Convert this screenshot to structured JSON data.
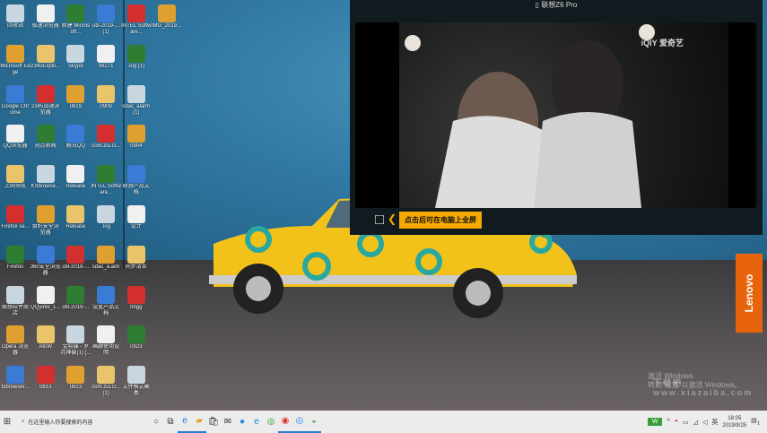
{
  "desktop": {
    "columns": [
      [
        "回收站",
        "Microsoft Edge",
        "Google Chrome",
        "QQ浏览器",
        "上网导航",
        "Firefox se...",
        "Firefox",
        "联想软件商店",
        "Opera 浏览器",
        "tsbrowser..."
      ],
      [
        "极速浏览器",
        "2345Explo...",
        "2345加速浏览器",
        "热点新闻",
        "KSbrowse...",
        "猎豹安全浏览器",
        "360安全浏览器",
        "QQyinle_1...",
        "AtoW",
        "0813"
      ],
      [
        "新建 Microsoft...",
        "Skype",
        "0819",
        "腾讯QQ",
        "Release",
        "Release",
        "util-2019-...",
        "util-2019-...",
        "金软碟 - 岁月神偷(1) [...",
        "0823"
      ],
      [
        "util-2019-... (1)",
        "08271",
        "0909",
        "com.zui.cl...",
        "INTEL Software...",
        ".log",
        "sdac_a.aim",
        "设置产品文档",
        "画廊使用说明",
        "com.zui.cl... (1)"
      ],
      [
        "INTEL Software...",
        ".log (1)",
        "sdac_alarm (1)",
        "0904",
        "联想产品文档",
        "设计",
        "同步清单",
        "hhgg",
        "0923",
        "文件格式聚类"
      ],
      [
        "IMG_2019..."
      ]
    ],
    "colors": [
      "#c8d6e0",
      "#e0a030",
      "#3a7bd5",
      "#f0f0f0",
      "#e9c46a",
      "#d32f2f",
      "#2e7d32"
    ]
  },
  "panel": {
    "device": "联想Z6 Pro",
    "watermark": "爱奇艺",
    "tooltip": "点击后可在电脑上全屏"
  },
  "lenovo": "Lenovo",
  "activate": {
    "line1": "激活 Windows",
    "line2": "转到\"设置\"以激活 Windows。"
  },
  "watermark": "下载吧 www.xiazaiba.com",
  "taskbar": {
    "search_placeholder": "在这里输入你要搜索的内容",
    "ime": "英",
    "time": "18:05",
    "date": "2019/9/25",
    "notification_count": "1"
  }
}
